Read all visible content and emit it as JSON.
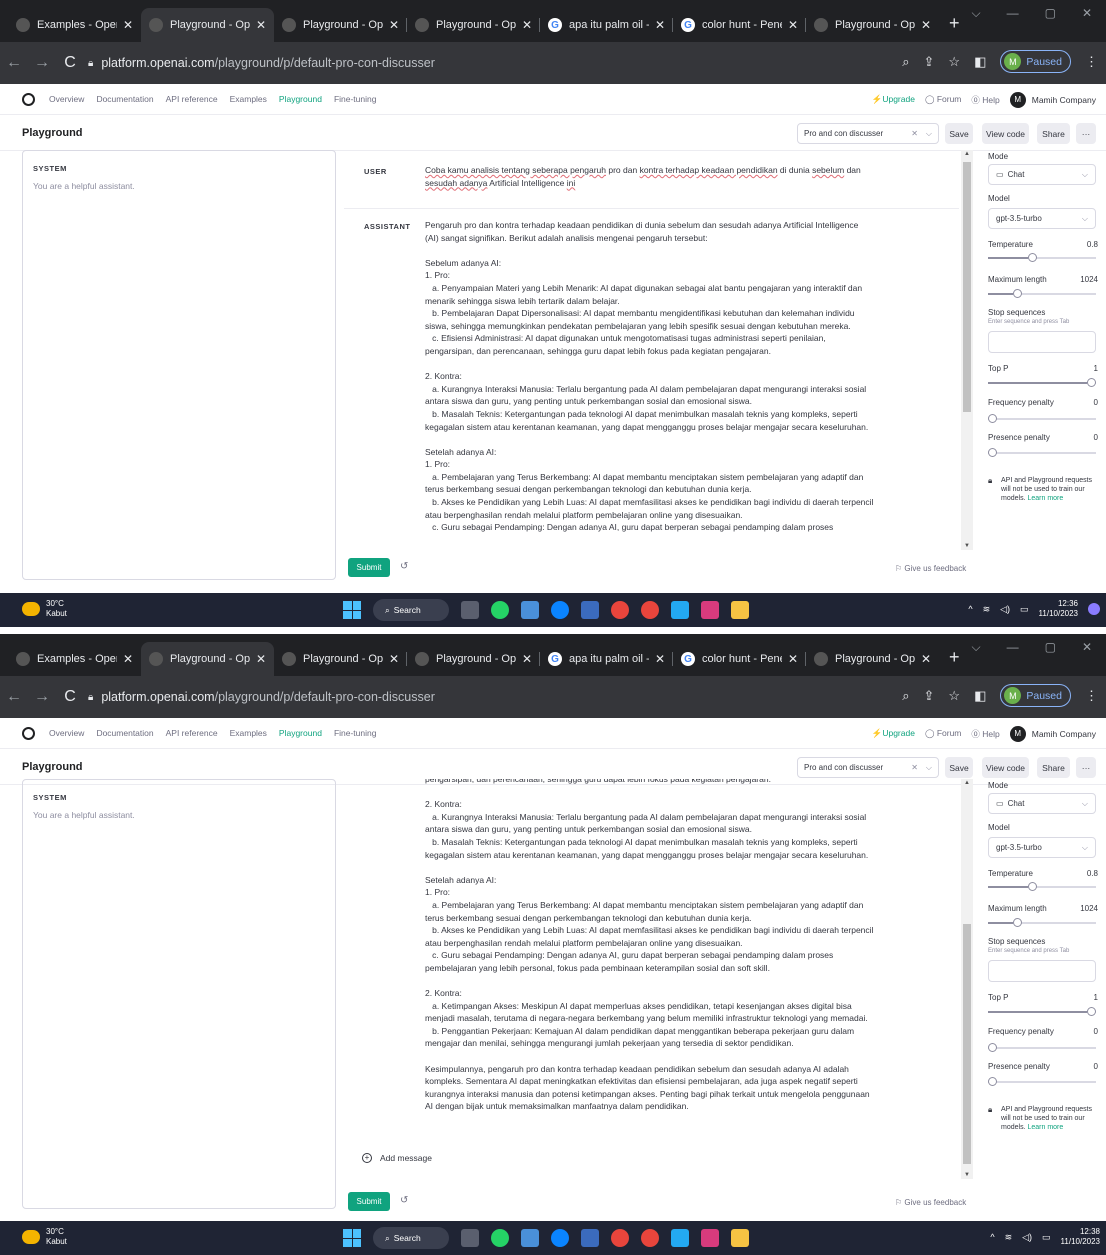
{
  "browser": {
    "tabs": [
      {
        "title": "Examples - OpenAI",
        "active": false,
        "icon": "openai-icon"
      },
      {
        "title": "Playground - Open",
        "active": true,
        "icon": "openai-icon"
      },
      {
        "title": "Playground - Open",
        "active": false,
        "icon": "openai-icon"
      },
      {
        "title": "Playground - Open",
        "active": false,
        "icon": "openai-icon"
      },
      {
        "title": "apa itu palm oil - P",
        "active": false,
        "icon": "google-icon"
      },
      {
        "title": "color hunt - Penelu",
        "active": false,
        "icon": "google-icon"
      },
      {
        "title": "Playground - Open",
        "active": false,
        "icon": "openai-icon"
      }
    ],
    "url_host": "platform.openai.com",
    "url_path": "/playground/p/default-pro-con-discusser",
    "profile_initial": "M",
    "profile_status": "Paused"
  },
  "nav": {
    "links": [
      "Overview",
      "Documentation",
      "API reference",
      "Examples",
      "Playground",
      "Fine-tuning"
    ],
    "active": "Playground",
    "upgrade": "Upgrade",
    "forum": "Forum",
    "help": "Help",
    "org_initial": "M",
    "org_name": "Mamih Company"
  },
  "header": {
    "title": "Playground",
    "preset": "Pro and con discusser",
    "save": "Save",
    "view_code": "View code",
    "share": "Share",
    "more": "···"
  },
  "system": {
    "label": "SYSTEM",
    "text": "You are a helpful assistant."
  },
  "conversation": {
    "user_role": "USER",
    "user_msg_parts": [
      "Coba kamu analisis tentang seberapa pengaruh",
      " pro dan ",
      "kontra terhadap keadaan pendidikan",
      " di dunia ",
      "sebelum",
      " dan",
      "sesudah adanya",
      " Artificial Intelligence ",
      "ini"
    ],
    "assistant_role": "ASSISTANT",
    "assistant_msg_top": "Pengaruh pro dan kontra terhadap keadaan pendidikan di dunia sebelum dan sesudah adanya Artificial Intelligence\n(AI) sangat signifikan. Berikut adalah analisis mengenai pengaruh tersebut:\n\nSebelum adanya AI:\n1. Pro:\n   a. Penyampaian Materi yang Lebih Menarik: AI dapat digunakan sebagai alat bantu pengajaran yang interaktif dan\nmenarik sehingga siswa lebih tertarik dalam belajar.\n   b. Pembelajaran Dapat Dipersonalisasi: AI dapat membantu mengidentifikasi kebutuhan dan kelemahan individu\nsiswa, sehingga memungkinkan pendekatan pembelajaran yang lebih spesifik sesuai dengan kebutuhan mereka.\n   c. Efisiensi Administrasi: AI dapat digunakan untuk mengotomatisasi tugas administrasi seperti penilaian,\npengarsipan, dan perencanaan, sehingga guru dapat lebih fokus pada kegiatan pengajaran.\n\n2. Kontra:\n   a. Kurangnya Interaksi Manusia: Terlalu bergantung pada AI dalam pembelajaran dapat mengurangi interaksi sosial\nantara siswa dan guru, yang penting untuk perkembangan sosial dan emosional siswa.\n   b. Masalah Teknis: Ketergantungan pada teknologi AI dapat menimbulkan masalah teknis yang kompleks, seperti\nkegagalan sistem atau kerentanan keamanan, yang dapat mengganggu proses belajar mengajar secara keseluruhan.\n\nSetelah adanya AI:\n1. Pro:\n   a. Pembelajaran yang Terus Berkembang: AI dapat membantu menciptakan sistem pembelajaran yang adaptif dan\nterus berkembang sesuai dengan perkembangan teknologi dan kebutuhan dunia kerja.\n   b. Akses ke Pendidikan yang Lebih Luas: AI dapat memfasilitasi akses ke pendidikan bagi individu di daerah terpencil\natau berpenghasilan rendah melalui platform pembelajaran online yang disesuaikan.\n   c. Guru sebagai Pendamping: Dengan adanya AI, guru dapat berperan sebagai pendamping dalam proses",
    "assistant_msg_bottom": "pengarsipan, dan perencanaan, sehingga guru dapat lebih fokus pada kegiatan pengajaran.\n\n2. Kontra:\n   a. Kurangnya Interaksi Manusia: Terlalu bergantung pada AI dalam pembelajaran dapat mengurangi interaksi sosial\nantara siswa dan guru, yang penting untuk perkembangan sosial dan emosional siswa.\n   b. Masalah Teknis: Ketergantungan pada teknologi AI dapat menimbulkan masalah teknis yang kompleks, seperti\nkegagalan sistem atau kerentanan keamanan, yang dapat mengganggu proses belajar mengajar secara keseluruhan.\n\nSetelah adanya AI:\n1. Pro:\n   a. Pembelajaran yang Terus Berkembang: AI dapat membantu menciptakan sistem pembelajaran yang adaptif dan\nterus berkembang sesuai dengan perkembangan teknologi dan kebutuhan dunia kerja.\n   b. Akses ke Pendidikan yang Lebih Luas: AI dapat memfasilitasi akses ke pendidikan bagi individu di daerah terpencil\natau berpenghasilan rendah melalui platform pembelajaran online yang disesuaikan.\n   c. Guru sebagai Pendamping: Dengan adanya AI, guru dapat berperan sebagai pendamping dalam proses\npembelajaran yang lebih personal, fokus pada pembinaan keterampilan sosial dan soft skill.\n\n2. Kontra:\n   a. Ketimpangan Akses: Meskipun AI dapat memperluas akses pendidikan, tetapi kesenjangan akses digital bisa\nmenjadi masalah, terutama di negara-negara berkembang yang belum memiliki infrastruktur teknologi yang memadai.\n   b. Penggantian Pekerjaan: Kemajuan AI dalam pendidikan dapat menggantikan beberapa pekerjaan guru dalam\nmengajar dan menilai, sehingga mengurangi jumlah pekerjaan yang tersedia di sektor pendidikan.\n\nKesimpulannya, pengaruh pro dan kontra terhadap keadaan pendidikan sebelum dan sesudah adanya AI adalah\nkompleks. Sementara AI dapat meningkatkan efektivitas dan efisiensi pembelajaran, ada juga aspek negatif seperti\nkurangnya interaksi manusia dan potensi ketimpangan akses. Penting bagi pihak terkait untuk mengelola penggunaan\nAI dengan bijak untuk memaksimalkan manfaatnya dalam pendidikan.",
    "add_message": "Add message",
    "submit": "Submit",
    "feedback": "Give us feedback"
  },
  "settings": {
    "mode_label": "Mode",
    "mode_value": "Chat",
    "model_label": "Model",
    "model_value": "gpt-3.5-turbo",
    "temperature_label": "Temperature",
    "temperature_value": "0.8",
    "temperature_fraction": 0.4,
    "max_length_label": "Maximum length",
    "max_length_value": "1024",
    "max_length_fraction": 0.25,
    "stop_label": "Stop sequences",
    "stop_hint": "Enter sequence and press Tab",
    "top_p_label": "Top P",
    "top_p_value": "1",
    "top_p_fraction": 1,
    "freq_label": "Frequency penalty",
    "freq_value": "0",
    "freq_fraction": 0,
    "presence_label": "Presence penalty",
    "presence_value": "0",
    "presence_fraction": 0,
    "notice": "API and Playground requests will not be used to train our models.",
    "learn_more": "Learn more"
  },
  "taskbar": {
    "temp": "30°C",
    "weather": "Kabut",
    "search": "Search",
    "time1": "12:36",
    "time2": "12:38",
    "date": "11/10/2023"
  },
  "colors": {
    "accent": "#10a37f",
    "browser_dark": "#202124",
    "taskbar": "#1f2434"
  }
}
